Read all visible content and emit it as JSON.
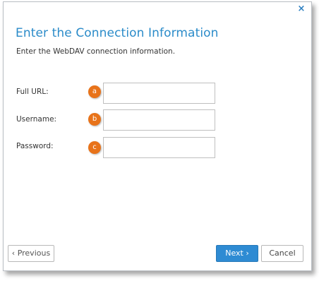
{
  "dialog": {
    "close_glyph": "×",
    "title": "Enter the Connection Information",
    "subtitle": "Enter the WebDAV connection information."
  },
  "fields": [
    {
      "label": "Full URL:",
      "badge": "a",
      "value": ""
    },
    {
      "label": "Username:",
      "badge": "b",
      "value": ""
    },
    {
      "label": "Password:",
      "badge": "c",
      "value": ""
    }
  ],
  "buttons": {
    "previous": "‹ Previous",
    "next": "Next ›",
    "cancel": "Cancel"
  },
  "colors": {
    "accent": "#2b8bc9",
    "badge": "#e8731a",
    "primary_button": "#2e8bd3"
  }
}
